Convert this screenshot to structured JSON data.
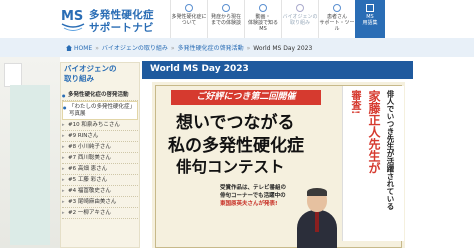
{
  "header": {
    "logo_line1": "多発性硬化症",
    "logo_line2": "サポートナビ",
    "nav": [
      {
        "label": "多発性硬化症に\nついて",
        "icon": "info-icon",
        "dim": false
      },
      {
        "label": "発症から現在\nまでの体験談",
        "icon": "people-icon",
        "dim": false
      },
      {
        "label": "動画・\n体験談で知るMS",
        "icon": "video-icon",
        "dim": false
      },
      {
        "label": "バイオジェンの\n取り組み",
        "icon": "hands-icon",
        "dim": true
      },
      {
        "label": "患者さん\nサポート・ツール",
        "icon": "support-icon",
        "dim": false
      },
      {
        "label": "MS\n用語集",
        "icon": "book-icon",
        "dim": false
      }
    ]
  },
  "breadcrumb": {
    "home": "HOME",
    "items": [
      "バイオジェンの取り組み",
      "多発性硬化症の啓発活動",
      "World MS Day 2023"
    ]
  },
  "sidebar": {
    "title": "バイオジェンの\n取り組み",
    "items": [
      {
        "label": "多発性硬化症の啓発活動",
        "type": "head"
      },
      {
        "label": "「わたしの多発性硬化症」写真展",
        "type": "active"
      },
      {
        "label": "#10 和泉みちこさん",
        "type": "sub"
      },
      {
        "label": "#9 RINさん",
        "type": "sub"
      },
      {
        "label": "#8 小川純子さん",
        "type": "sub"
      },
      {
        "label": "#7 西川聡美さん",
        "type": "sub"
      },
      {
        "label": "#6 高畑 恵さん",
        "type": "sub"
      },
      {
        "label": "#5 工藤 彩さん",
        "type": "sub"
      },
      {
        "label": "#4 福冨敬史さん",
        "type": "sub"
      },
      {
        "label": "#3 尾崎麻由美さん",
        "type": "sub"
      },
      {
        "label": "#2 一柳アキさん",
        "type": "sub"
      }
    ]
  },
  "main": {
    "title": "World MS Day 2023",
    "banner": {
      "pretitle": "ご好評につき第二回開催",
      "line1": "想いでつながる",
      "line2": "私の多発性硬化症",
      "line3": "俳句コンテスト",
      "vertical1": "俳人でいつき先生が活躍されている",
      "vertical2": "家藤正人先生が",
      "vertical3": "審査!",
      "desc_line1": "受賞作品は、テレビ番組の",
      "desc_line2": "俳句コーナーでも活躍中の",
      "desc_line3": "東国原英夫さんが発表!"
    }
  },
  "colors": {
    "brand": "#2a6db5",
    "title_bar": "#1f5a9e",
    "accent_red": "#d63a2f"
  }
}
